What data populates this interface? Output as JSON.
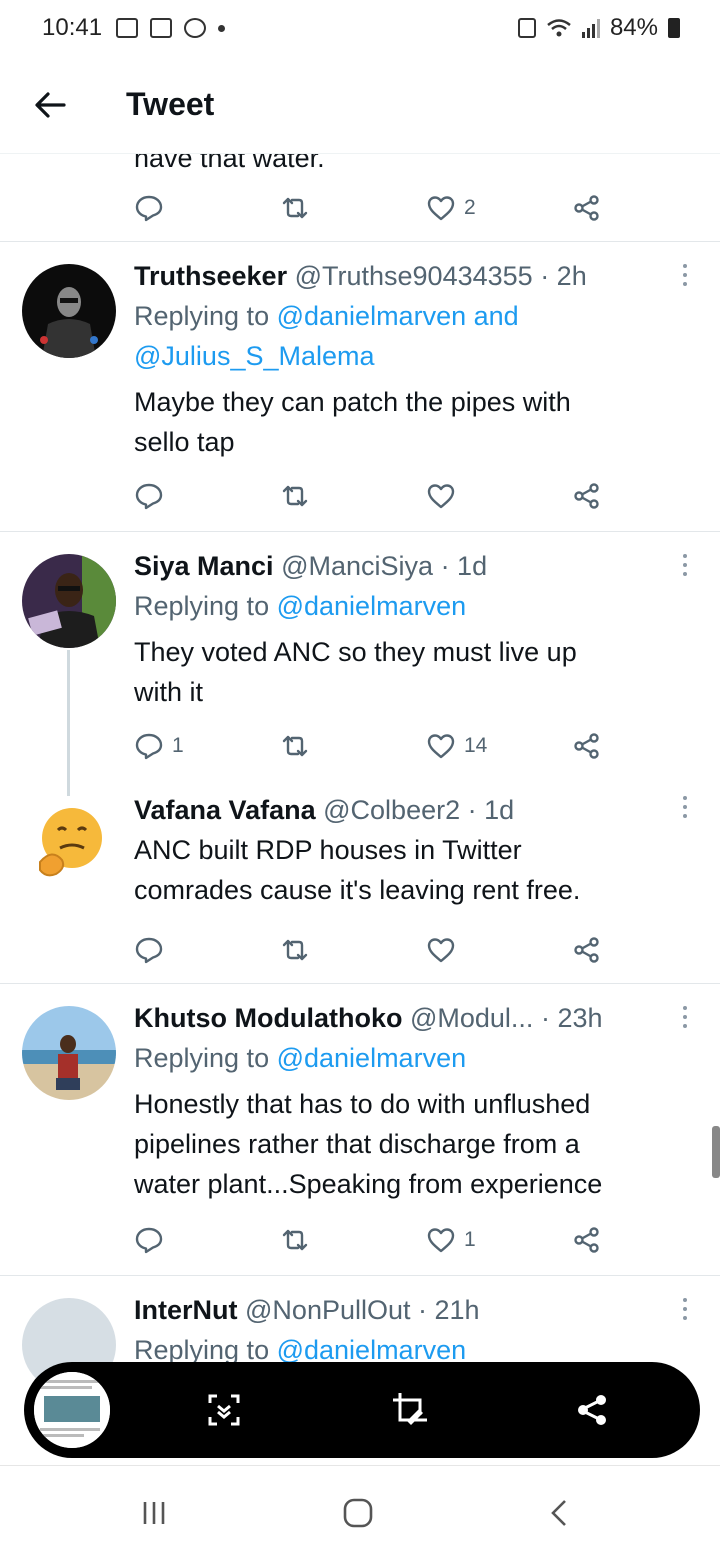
{
  "status_bar": {
    "time": "10:41",
    "battery": "84%"
  },
  "header": {
    "title": "Tweet",
    "back_icon": "arrow-left-icon"
  },
  "feed": {
    "cut_off_text": "have that water.",
    "cut_off_actions": {
      "like_count": "2"
    },
    "tweets": [
      {
        "name": "Truthseeker",
        "handle": "@Truthse90434355",
        "time": "· 2h",
        "replying_prefix": "Replying to ",
        "replying_to": "@danielmarven and",
        "replying_to_2": "@Julius_S_Malema",
        "text_1": "Maybe they can patch the pipes with",
        "text_2": "sello tap",
        "reply_count": "",
        "like_count": ""
      },
      {
        "name": "Siya Manci",
        "handle": "@ManciSiya",
        "time": "· 1d",
        "replying_prefix": "Replying to ",
        "replying_to": "@danielmarven",
        "text_1": "They voted ANC so they must live up",
        "text_2": "with it",
        "reply_count": "1",
        "like_count": "14"
      },
      {
        "name": "Vafana Vafana",
        "handle": "@Colbeer2",
        "time": "· 1d",
        "text_1": "ANC built RDP houses in Twitter",
        "text_2": "comrades cause it's leaving rent free.",
        "reply_count": "",
        "like_count": ""
      },
      {
        "name": "Khutso Modulathoko",
        "handle": "@Modul...",
        "time": "· 23h",
        "replying_prefix": "Replying to ",
        "replying_to": "@danielmarven",
        "text_1": "Honestly that has to do with unflushed",
        "text_2": "pipelines rather that discharge from a",
        "text_3": "water plant...Speaking from experience",
        "reply_count": "",
        "like_count": "1"
      },
      {
        "name": "InterNut",
        "handle": "@NonPullOut",
        "time": "· 21h",
        "replying_prefix": "Replying to ",
        "replying_to": "@danielmarven"
      }
    ]
  },
  "screenshot_toolbar": {
    "icons": [
      "scroll-capture-icon",
      "crop-edit-icon",
      "share-icon"
    ]
  },
  "nav_bar": {
    "icons": [
      "recent-apps-icon",
      "home-icon",
      "back-icon"
    ]
  },
  "colors": {
    "accent": "#1d9bf0",
    "text": "#0f1419",
    "muted": "#536471"
  }
}
